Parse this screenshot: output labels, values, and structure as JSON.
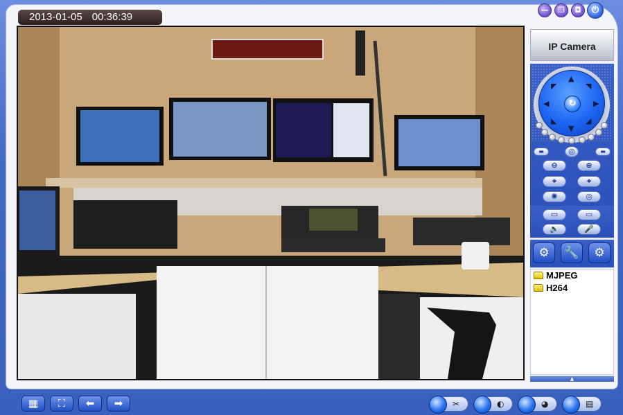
{
  "header": {
    "date": "2013-01-05",
    "time": "00:36:39"
  },
  "window_controls": [
    {
      "name": "minimize",
      "glyph": "—"
    },
    {
      "name": "restore",
      "glyph": "❐"
    },
    {
      "name": "fullscreen",
      "glyph": "◘"
    },
    {
      "name": "power",
      "glyph": "⏻"
    }
  ],
  "panel": {
    "title": "IP Camera",
    "streams": [
      "MJPEG",
      "H264"
    ]
  },
  "icons": {
    "dial_center": "refresh-icon",
    "zoom_out": "zoom-out-icon",
    "zoom_in": "zoom-in-icon",
    "settings": "gear-icon",
    "tools": "wrench-icon",
    "advanced": "gear-advanced-icon"
  },
  "colors": {
    "accent": "#3a5fbd",
    "dial": "#1c64f2",
    "folder": "#e3c000"
  }
}
